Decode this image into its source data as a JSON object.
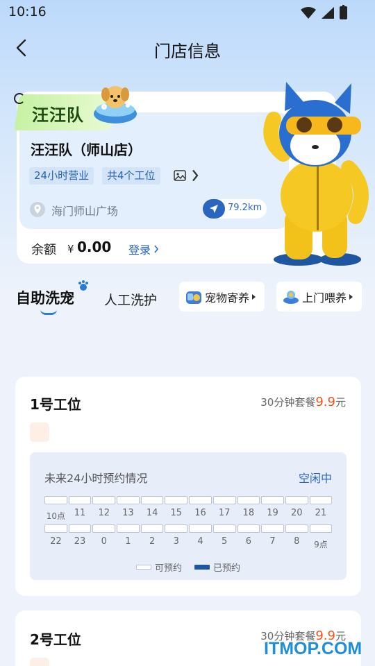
{
  "status_bar": {
    "time": "10:16"
  },
  "header": {
    "title": "门店信息"
  },
  "store": {
    "badge": "汪汪队",
    "name": "汪汪队（师山店）",
    "tags": [
      "24小时营业",
      "共4个工位"
    ],
    "address": "海门师山广场",
    "distance": "79.2km",
    "balance_label": "余额",
    "currency": "¥",
    "balance": "0.00",
    "login": "登录"
  },
  "tabs": {
    "self_service": "自助洗宠",
    "manual": "人工洗护"
  },
  "services": {
    "boarding": "宠物寄养",
    "visit": "上门喂养"
  },
  "stations": [
    {
      "title": "1号工位",
      "price_prefix": "30分钟套餐",
      "price": "9.9",
      "price_unit": "元",
      "availability_title": "未来24小时预约情况",
      "status": "空闲中",
      "hours_row1": [
        "10点",
        "11",
        "12",
        "13",
        "14",
        "15",
        "16",
        "17",
        "18",
        "19",
        "20",
        "21"
      ],
      "hours_row2": [
        "22",
        "23",
        "0",
        "1",
        "2",
        "3",
        "4",
        "5",
        "6",
        "7",
        "8",
        "9点"
      ],
      "booked_row1": [
        false,
        false,
        false,
        false,
        false,
        false,
        false,
        false,
        false,
        false,
        false,
        false
      ],
      "booked_row2": [
        false,
        false,
        false,
        false,
        false,
        false,
        false,
        false,
        false,
        false,
        false,
        false
      ],
      "legend_free": "可预约",
      "legend_booked": "已预约"
    },
    {
      "title": "2号工位",
      "price_prefix": "30分钟套餐",
      "price": "9.9",
      "price_unit": "元"
    }
  ],
  "watermark": "ITMOP.COM",
  "colors": {
    "accent": "#2a66c0",
    "price": "#ef5318",
    "booked": "#1f56a2",
    "badge": "#c7f1a4"
  }
}
